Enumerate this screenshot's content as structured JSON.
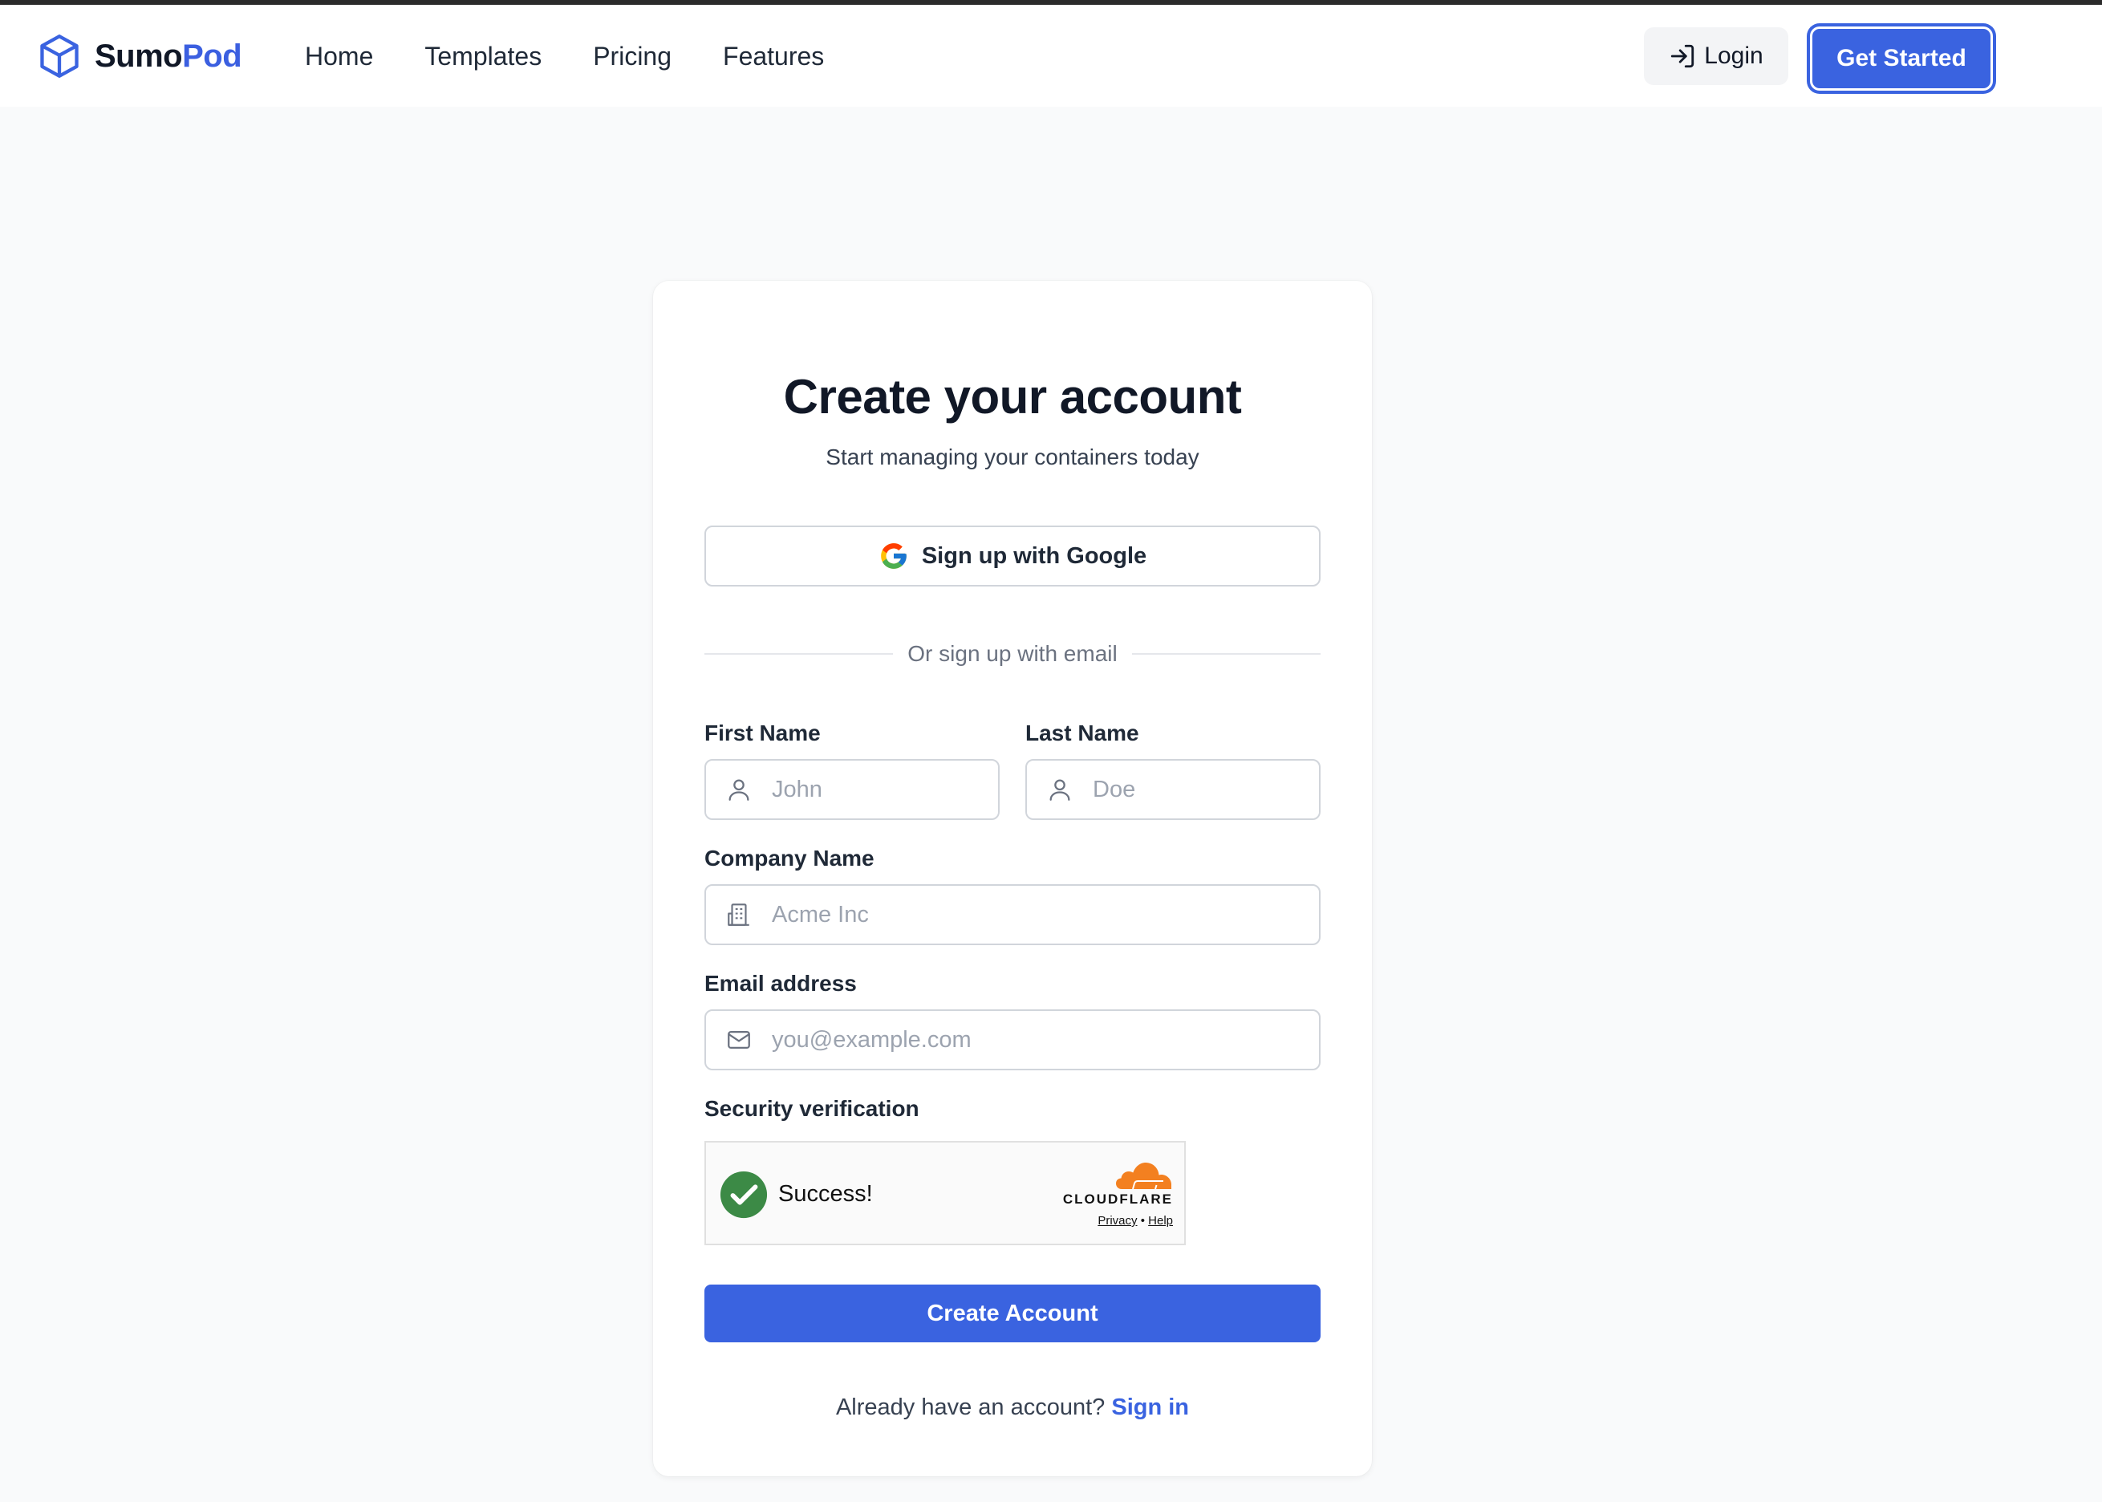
{
  "nav": {
    "brand_part1": "Sumo",
    "brand_part2": "Pod",
    "links": [
      "Home",
      "Templates",
      "Pricing",
      "Features"
    ],
    "login_label": "Login",
    "get_started_label": "Get Started"
  },
  "form": {
    "title": "Create your account",
    "subtitle": "Start managing your containers today",
    "google_label": "Sign up with Google",
    "divider_text": "Or sign up with email",
    "first_name": {
      "label": "First Name",
      "placeholder": "John",
      "value": ""
    },
    "last_name": {
      "label": "Last Name",
      "placeholder": "Doe",
      "value": ""
    },
    "company": {
      "label": "Company Name",
      "placeholder": "Acme Inc",
      "value": ""
    },
    "email": {
      "label": "Email address",
      "placeholder": "you@example.com",
      "value": ""
    },
    "security_label": "Security verification",
    "turnstile": {
      "status": "Success!",
      "provider": "CLOUDFLARE",
      "privacy": "Privacy",
      "separator": "•",
      "help": "Help"
    },
    "submit_label": "Create Account",
    "signin_prompt": "Already have an account?",
    "signin_link": "Sign in"
  },
  "colors": {
    "accent": "#3a63e0",
    "success": "#3c8a46",
    "cloudflare": "#f38020"
  },
  "icons": {
    "brand": "cube-icon",
    "login": "login-arrow-icon",
    "google": "google-icon",
    "user": "user-icon",
    "company": "building-icon",
    "email": "mail-icon",
    "success": "checkmark-circle-icon"
  }
}
